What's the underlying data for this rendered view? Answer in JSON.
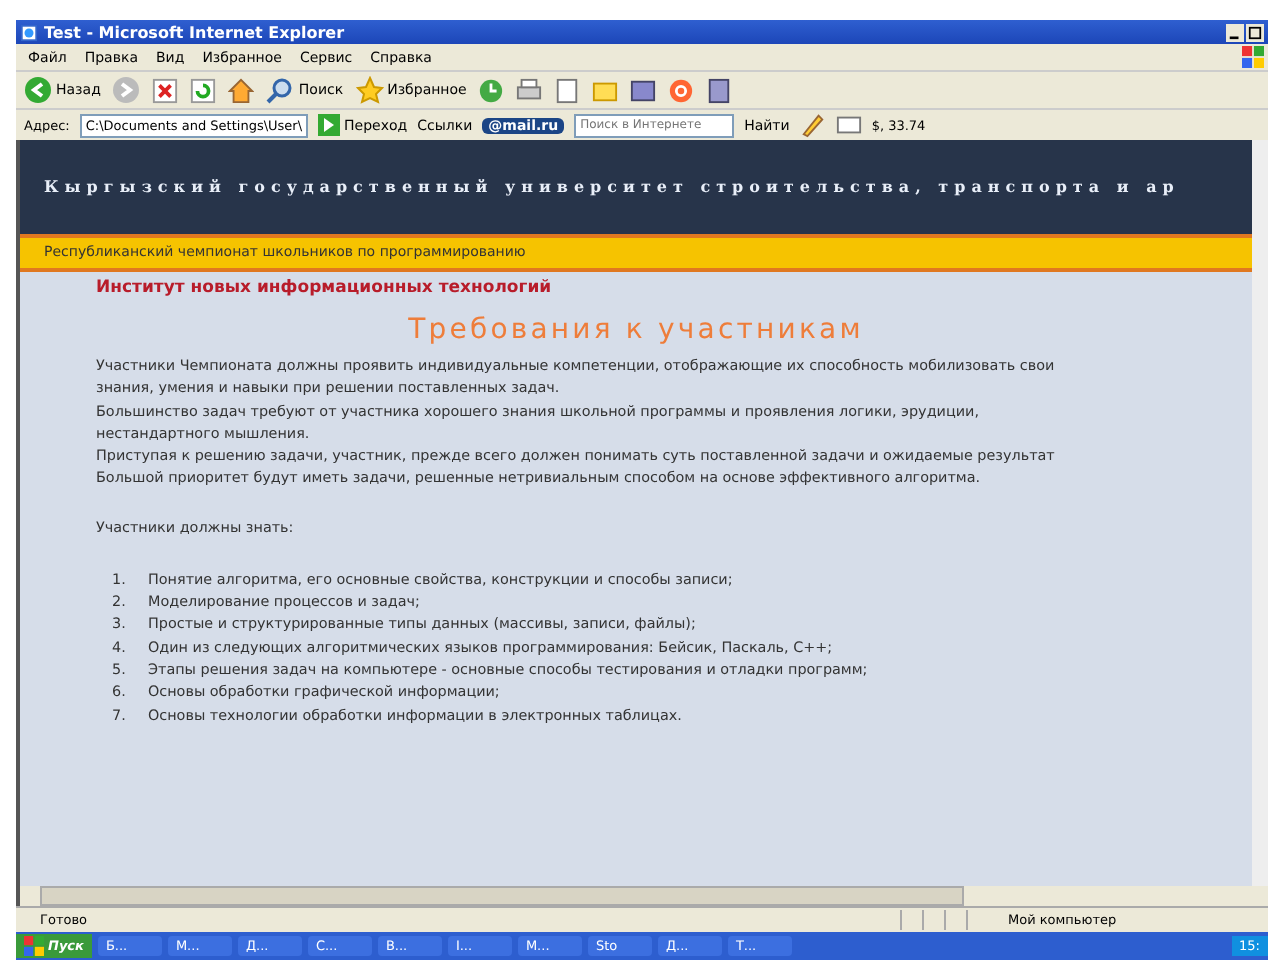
{
  "window": {
    "title": "Test - Microsoft Internet Explorer"
  },
  "menu": [
    "Файл",
    "Правка",
    "Вид",
    "Избранное",
    "Сервис",
    "Справка"
  ],
  "toolbar": {
    "back": "Назад",
    "search": "Поиск",
    "favorites": "Избранное"
  },
  "address_bar": {
    "label": "Адрес:",
    "value": "C:\\Documents and Settings\\User\\",
    "go": "Переход",
    "links": "Ссылки",
    "mail": "@mail.ru",
    "search_placeholder": "Поиск в Интернете",
    "find": "Найти",
    "rate": "$, 33.74"
  },
  "page": {
    "university": "Кыргызский государственный университет строительства, транспорта и ар",
    "banner": "Республиканский чемпионат школьников по программированию",
    "institute": "Институт новых информационных технологий",
    "heading": "Требования к участникам",
    "paragraph_lines": [
      "Участники Чемпионата должны проявить индивидуальные компетенции, отображающие их способность мобилизовать свои",
      "знания, умения и навыки при решении поставленных задач.",
      "Большинство задач требуют от участника хорошего знания школьной программы и проявления логики, эрудиции,",
      "нестандартного мышления.",
      "Приступая к решению задачи, участник, прежде всего должен понимать суть поставленной задачи и ожидаемые результат",
      "Большой приоритет будут иметь задачи, решенные нетривиальным способом на основе эффективного алгоритма."
    ],
    "list_title": "Участники должны знать:",
    "list": [
      {
        "number": "1.",
        "text": "Понятие алгоритма, его основные свойства, конструкции  и способы записи;"
      },
      {
        "number": "2.",
        "text": "Моделирование процессов и задач;"
      },
      {
        "number": "3.",
        "text": "Простые и структурированные типы данных (массивы, записи, файлы);"
      },
      {
        "number": "4.",
        "text": "Один из следующих алгоритмических языков программирования: Бейсик, Паскаль, С++;"
      },
      {
        "number": "5.",
        "text": "Этапы решения задач на компьютере - основные способы  тестирования и отладки программ;"
      },
      {
        "number": "6.",
        "text": "Основы обработки графической информации;"
      },
      {
        "number": "7.",
        "text": "Основы технологии обработки информации в электронных таблицах."
      }
    ]
  },
  "status_bar": {
    "status": "Готово",
    "zone": "Мой компьютер"
  },
  "taskbar": {
    "start": "Пуск",
    "tasks": [
      "Б...",
      "М...",
      "Д...",
      "С...",
      "В...",
      "I...",
      "М...",
      "Sto",
      "Д...",
      "Т..."
    ],
    "clock": "15:"
  }
}
